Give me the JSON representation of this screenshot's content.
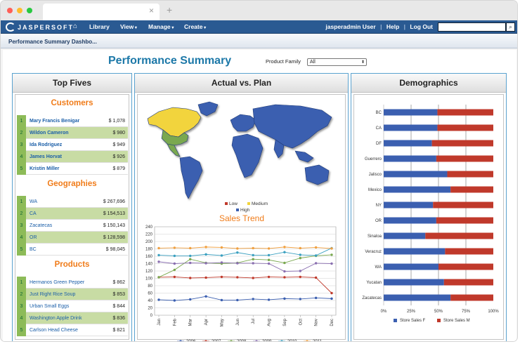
{
  "browser": {
    "close_glyph": "×",
    "new_tab_glyph": "+"
  },
  "app": {
    "logo": "JASPERSOFT",
    "nav": [
      {
        "label": "Library",
        "has_menu": false
      },
      {
        "label": "View",
        "has_menu": true
      },
      {
        "label": "Manage",
        "has_menu": true
      },
      {
        "label": "Create",
        "has_menu": true
      }
    ],
    "user": "jasperadmin User",
    "help": "Help",
    "logout": "Log Out",
    "search_placeholder": "",
    "icons": {
      "home": "home-icon",
      "search": "search-icon"
    }
  },
  "breadcrumb": "Performance Summary Dashbo...",
  "dashboard": {
    "title": "Performance Summary",
    "product_family_label": "Product Family",
    "product_family_value": "All"
  },
  "top_fives": {
    "title": "Top Fives",
    "sections": [
      {
        "title": "Customers",
        "bold_names": true,
        "rows": [
          {
            "rank": "1",
            "name": "Mary Francis Benigar",
            "value": "$ 1,078"
          },
          {
            "rank": "2",
            "name": "Wildon Cameron",
            "value": "$ 980"
          },
          {
            "rank": "3",
            "name": "Ida Rodriguez",
            "value": "$ 949"
          },
          {
            "rank": "4",
            "name": "James Horvat",
            "value": "$ 926"
          },
          {
            "rank": "5",
            "name": "Kristin Miller",
            "value": "$ 879"
          }
        ]
      },
      {
        "title": "Geographies",
        "bold_names": false,
        "rows": [
          {
            "rank": "1",
            "name": "WA",
            "value": "$ 267,696"
          },
          {
            "rank": "2",
            "name": "CA",
            "value": "$ 154,513"
          },
          {
            "rank": "3",
            "name": "Zacatecas",
            "value": "$ 150,143"
          },
          {
            "rank": "4",
            "name": "OR",
            "value": "$ 128,598"
          },
          {
            "rank": "5",
            "name": "BC",
            "value": "$ 98,045"
          }
        ]
      },
      {
        "title": "Products",
        "bold_names": false,
        "rows": [
          {
            "rank": "1",
            "name": "Hermanos Green Pepper",
            "value": "$ 862"
          },
          {
            "rank": "2",
            "name": "Just Right Rice Soup",
            "value": "$ 853"
          },
          {
            "rank": "3",
            "name": "Urban Small Eggs",
            "value": "$ 844"
          },
          {
            "rank": "4",
            "name": "Washington Apple Drink",
            "value": "$ 836"
          },
          {
            "rank": "5",
            "name": "Carlson Head Cheese",
            "value": "$ 821"
          }
        ]
      }
    ]
  },
  "actual_vs_plan": {
    "title": "Actual vs. Plan",
    "map_legend": [
      {
        "label": "Low",
        "color": "#c0392b"
      },
      {
        "label": "Medium",
        "color": "#f2d43c"
      },
      {
        "label": "High",
        "color": "#3b5fb0"
      }
    ],
    "map_colors": {
      "high": "#3b5fb0",
      "medium": "#f2d43c",
      "low": "#7aa84f"
    }
  },
  "chart_data": [
    {
      "type": "line",
      "title": "Sales Trend",
      "categories": [
        "Jan",
        "Feb",
        "Mar",
        "Apr",
        "May",
        "Jun",
        "Jul",
        "Aug",
        "Sep",
        "Oct",
        "Nov",
        "Dec"
      ],
      "ylim": [
        0,
        240
      ],
      "yticks": [
        0,
        20,
        40,
        60,
        80,
        100,
        120,
        140,
        160,
        180,
        200,
        220,
        240
      ],
      "grid": true,
      "legend": "bottom",
      "series": [
        {
          "name": "2006",
          "color": "#3b5fb0",
          "values": [
            42,
            40,
            43,
            51,
            41,
            41,
            44,
            42,
            45,
            44,
            47,
            45
          ]
        },
        {
          "name": "2007",
          "color": "#c0392b",
          "values": [
            103,
            104,
            101,
            102,
            104,
            103,
            101,
            104,
            103,
            104,
            102,
            60
          ]
        },
        {
          "name": "2008",
          "color": "#7aa84f",
          "values": [
            103,
            123,
            152,
            142,
            140,
            142,
            152,
            150,
            142,
            155,
            161,
            164
          ]
        },
        {
          "name": "2009",
          "color": "#8a6fb0",
          "values": [
            145,
            140,
            142,
            141,
            143,
            141,
            141,
            140,
            119,
            120,
            141,
            140
          ]
        },
        {
          "name": "2010",
          "color": "#3ba0c0",
          "values": [
            163,
            161,
            161,
            165,
            162,
            170,
            163,
            163,
            171,
            164,
            162,
            182
          ]
        },
        {
          "name": "2011",
          "color": "#f0a040",
          "values": [
            182,
            183,
            182,
            185,
            184,
            181,
            182,
            181,
            185,
            182,
            184,
            181
          ]
        }
      ]
    },
    {
      "type": "bar",
      "title": "Demographics",
      "stacked": "percent",
      "categories": [
        "BC",
        "CA",
        "DF",
        "Guerrero",
        "Jalisco",
        "Mexico",
        "NY",
        "OR",
        "Sinaloa",
        "Veracruz",
        "WA",
        "Yucatan",
        "Zacatecas"
      ],
      "xticks": [
        "0%",
        "25%",
        "50%",
        "75%",
        "100%"
      ],
      "legend": "bottom",
      "series": [
        {
          "name": "Store Sales F",
          "color": "#3b5fb0",
          "values": [
            49,
            49,
            44,
            48,
            58,
            61,
            45,
            48,
            38,
            56,
            50,
            55,
            61
          ]
        },
        {
          "name": "Store Sales M",
          "color": "#c0392b",
          "values": [
            51,
            51,
            56,
            52,
            42,
            39,
            55,
            52,
            62,
            44,
            50,
            45,
            39
          ]
        }
      ]
    }
  ],
  "demographics_title": "Demographics"
}
